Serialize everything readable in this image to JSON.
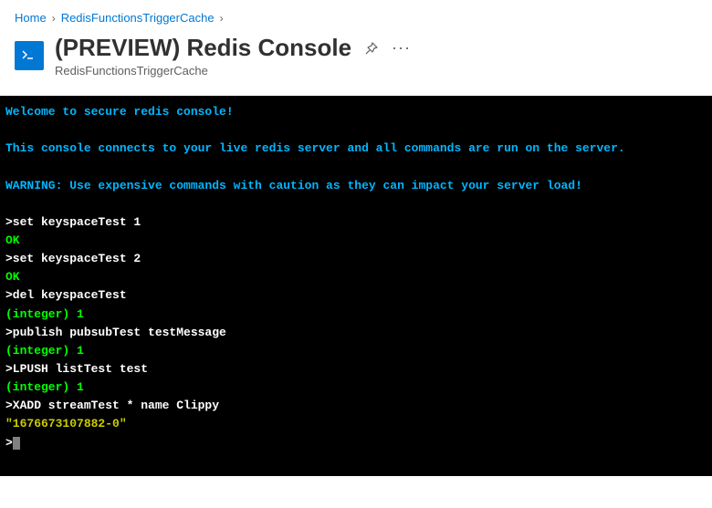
{
  "breadcrumb": {
    "items": [
      "Home",
      "RedisFunctionsTriggerCache"
    ]
  },
  "header": {
    "title": "(PREVIEW) Redis Console",
    "subtitle": "RedisFunctionsTriggerCache"
  },
  "console": {
    "welcome": "Welcome to secure redis console!",
    "info": "This console connects to your live redis server and all commands are run on the server.",
    "warning": "WARNING: Use expensive commands with caution as they can impact your server load!",
    "lines": [
      {
        "type": "cmd",
        "text": "set keyspaceTest 1"
      },
      {
        "type": "ok",
        "text": "OK"
      },
      {
        "type": "cmd",
        "text": "set keyspaceTest 2"
      },
      {
        "type": "ok",
        "text": "OK"
      },
      {
        "type": "cmd",
        "text": "del keyspaceTest"
      },
      {
        "type": "int",
        "text": "(integer) 1"
      },
      {
        "type": "cmd",
        "text": "publish pubsubTest testMessage"
      },
      {
        "type": "int",
        "text": "(integer) 1"
      },
      {
        "type": "cmd",
        "text": "LPUSH listTest test"
      },
      {
        "type": "int",
        "text": "(integer) 1"
      },
      {
        "type": "cmd",
        "text": "XADD streamTest * name Clippy"
      },
      {
        "type": "str",
        "text": "\"1676673107882-0\""
      }
    ],
    "prompt": ">"
  }
}
